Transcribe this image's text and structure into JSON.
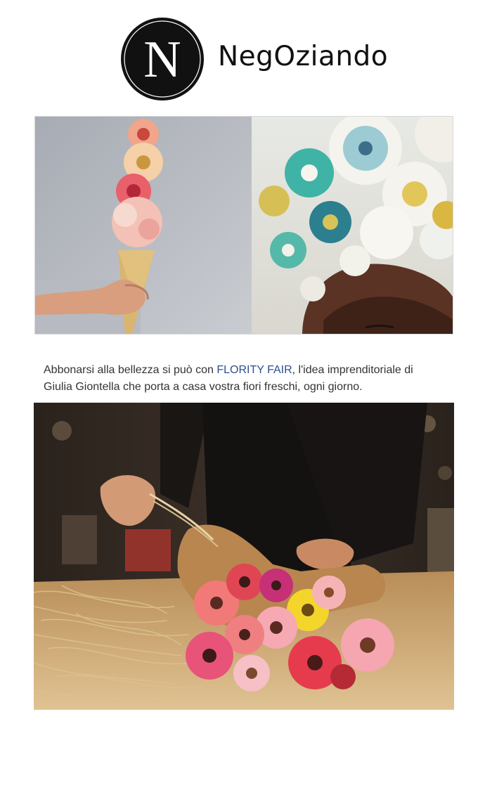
{
  "brand": {
    "logo_letter": "N",
    "name": "NegOziando"
  },
  "article": {
    "text_before_link": "Abbonarsi alla bellezza si può con ",
    "link_label": "FLORITY FAIR",
    "text_line_1_after": ", l'idea imprenditoriale di",
    "text_line_2": "Giulia Giontella che porta a casa vostra fiori freschi, ogni giorno."
  },
  "colors": {
    "link": "#2f4f8f",
    "text": "#333333",
    "logo_bg": "#111111"
  }
}
